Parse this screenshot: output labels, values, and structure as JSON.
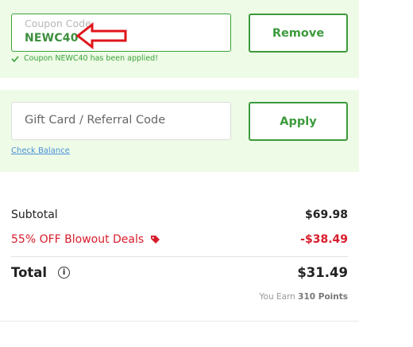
{
  "coupon": {
    "label": "Coupon Code",
    "value": "NEWC40",
    "remove_label": "Remove",
    "applied_message": "Coupon NEWC40 has been applied!"
  },
  "gift_card": {
    "placeholder": "Gift Card / Referral Code",
    "apply_label": "Apply",
    "check_balance_label": "Check Balance"
  },
  "summary": {
    "subtotal_label": "Subtotal",
    "subtotal_value": "$69.98",
    "discount_label": "55% OFF Blowout Deals",
    "discount_value": "-$38.49",
    "total_label": "Total",
    "total_value": "$31.49",
    "earn_prefix": "You Earn",
    "earn_points": "310 Points"
  },
  "colors": {
    "accent_green": "#3c9a3c",
    "panel_bg": "#eefbe6",
    "discount_red": "#d81c2b",
    "annotation_arrow": "#e0151c"
  },
  "icons": {
    "applied": "check-icon",
    "discount": "tag-icon",
    "total": "info-icon",
    "annotation": "red-arrow-icon"
  }
}
